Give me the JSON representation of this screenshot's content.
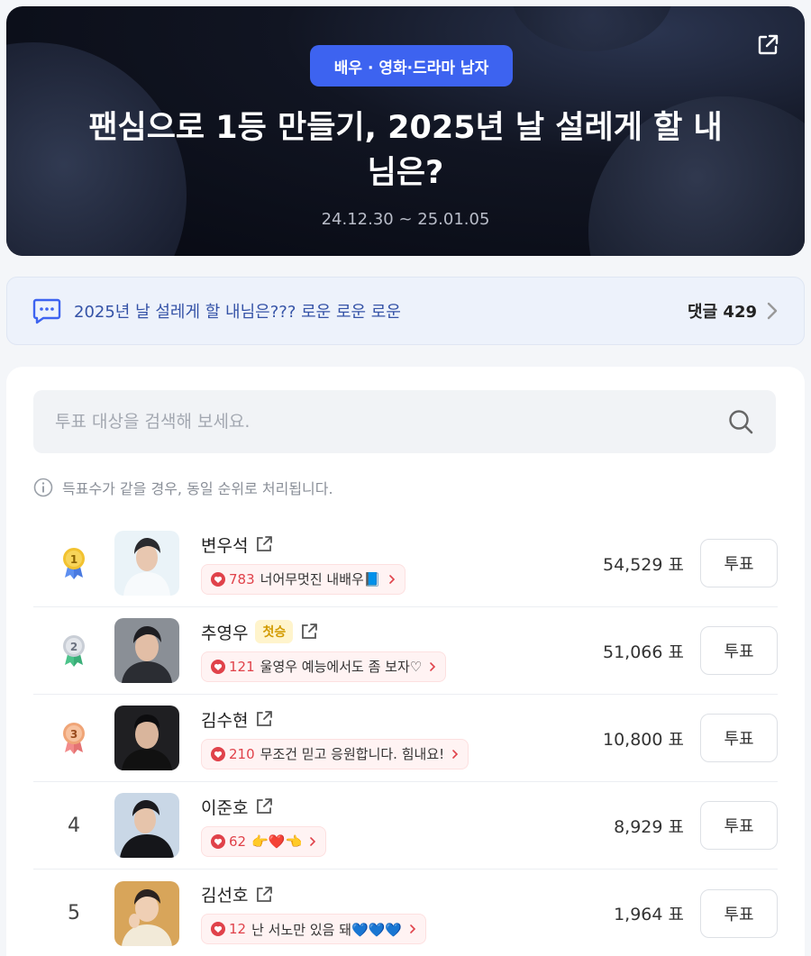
{
  "banner": {
    "category": "배우 · 영화·드라마 남자",
    "title": "팬심으로 1등 만들기, 2025년 날 설레게 할 내 님은?",
    "period": "24.12.30 ~ 25.01.05"
  },
  "comment_bar": {
    "text": "2025년 날 설레게 할 내님은??? 로운 로운 로운",
    "count_label": "댓글 429"
  },
  "search": {
    "placeholder": "투표 대상을 검색해 보세요."
  },
  "notice": "득표수가 같을 경우, 동일 순위로 처리됩니다.",
  "vote_button_label": "투표",
  "candidates": [
    {
      "rank": "1",
      "medal": "gold",
      "name": "변우석",
      "badge": "",
      "cheer_count": "783",
      "cheer_msg": "너어무멋진 내배우📘",
      "votes": "54,529 표"
    },
    {
      "rank": "2",
      "medal": "silver",
      "name": "추영우",
      "badge": "첫승",
      "cheer_count": "121",
      "cheer_msg": "울영우 예능에서도 좀 보자♡",
      "votes": "51,066 표"
    },
    {
      "rank": "3",
      "medal": "bronze",
      "name": "김수현",
      "badge": "",
      "cheer_count": "210",
      "cheer_msg": "무조건 믿고 응원합니다. 힘내요!",
      "votes": "10,800 표"
    },
    {
      "rank": "4",
      "medal": "",
      "name": "이준호",
      "badge": "",
      "cheer_count": "62",
      "cheer_msg": "👉❤️👈",
      "votes": "8,929 표"
    },
    {
      "rank": "5",
      "medal": "",
      "name": "김선호",
      "badge": "",
      "cheer_count": "12",
      "cheer_msg": "난 서노만 있음 돼💙💙💙",
      "votes": "1,964 표"
    }
  ],
  "colors": {
    "accent": "#3d63f0",
    "heart": "#e0424a",
    "gold": "#f2c230",
    "silver": "#c9ced6",
    "bronze": "#f0a577"
  },
  "icons": [
    "share-icon",
    "chat-icon",
    "chevron-right-icon",
    "search-icon",
    "info-icon",
    "medal-icon",
    "external-link-icon",
    "heart-icon"
  ]
}
